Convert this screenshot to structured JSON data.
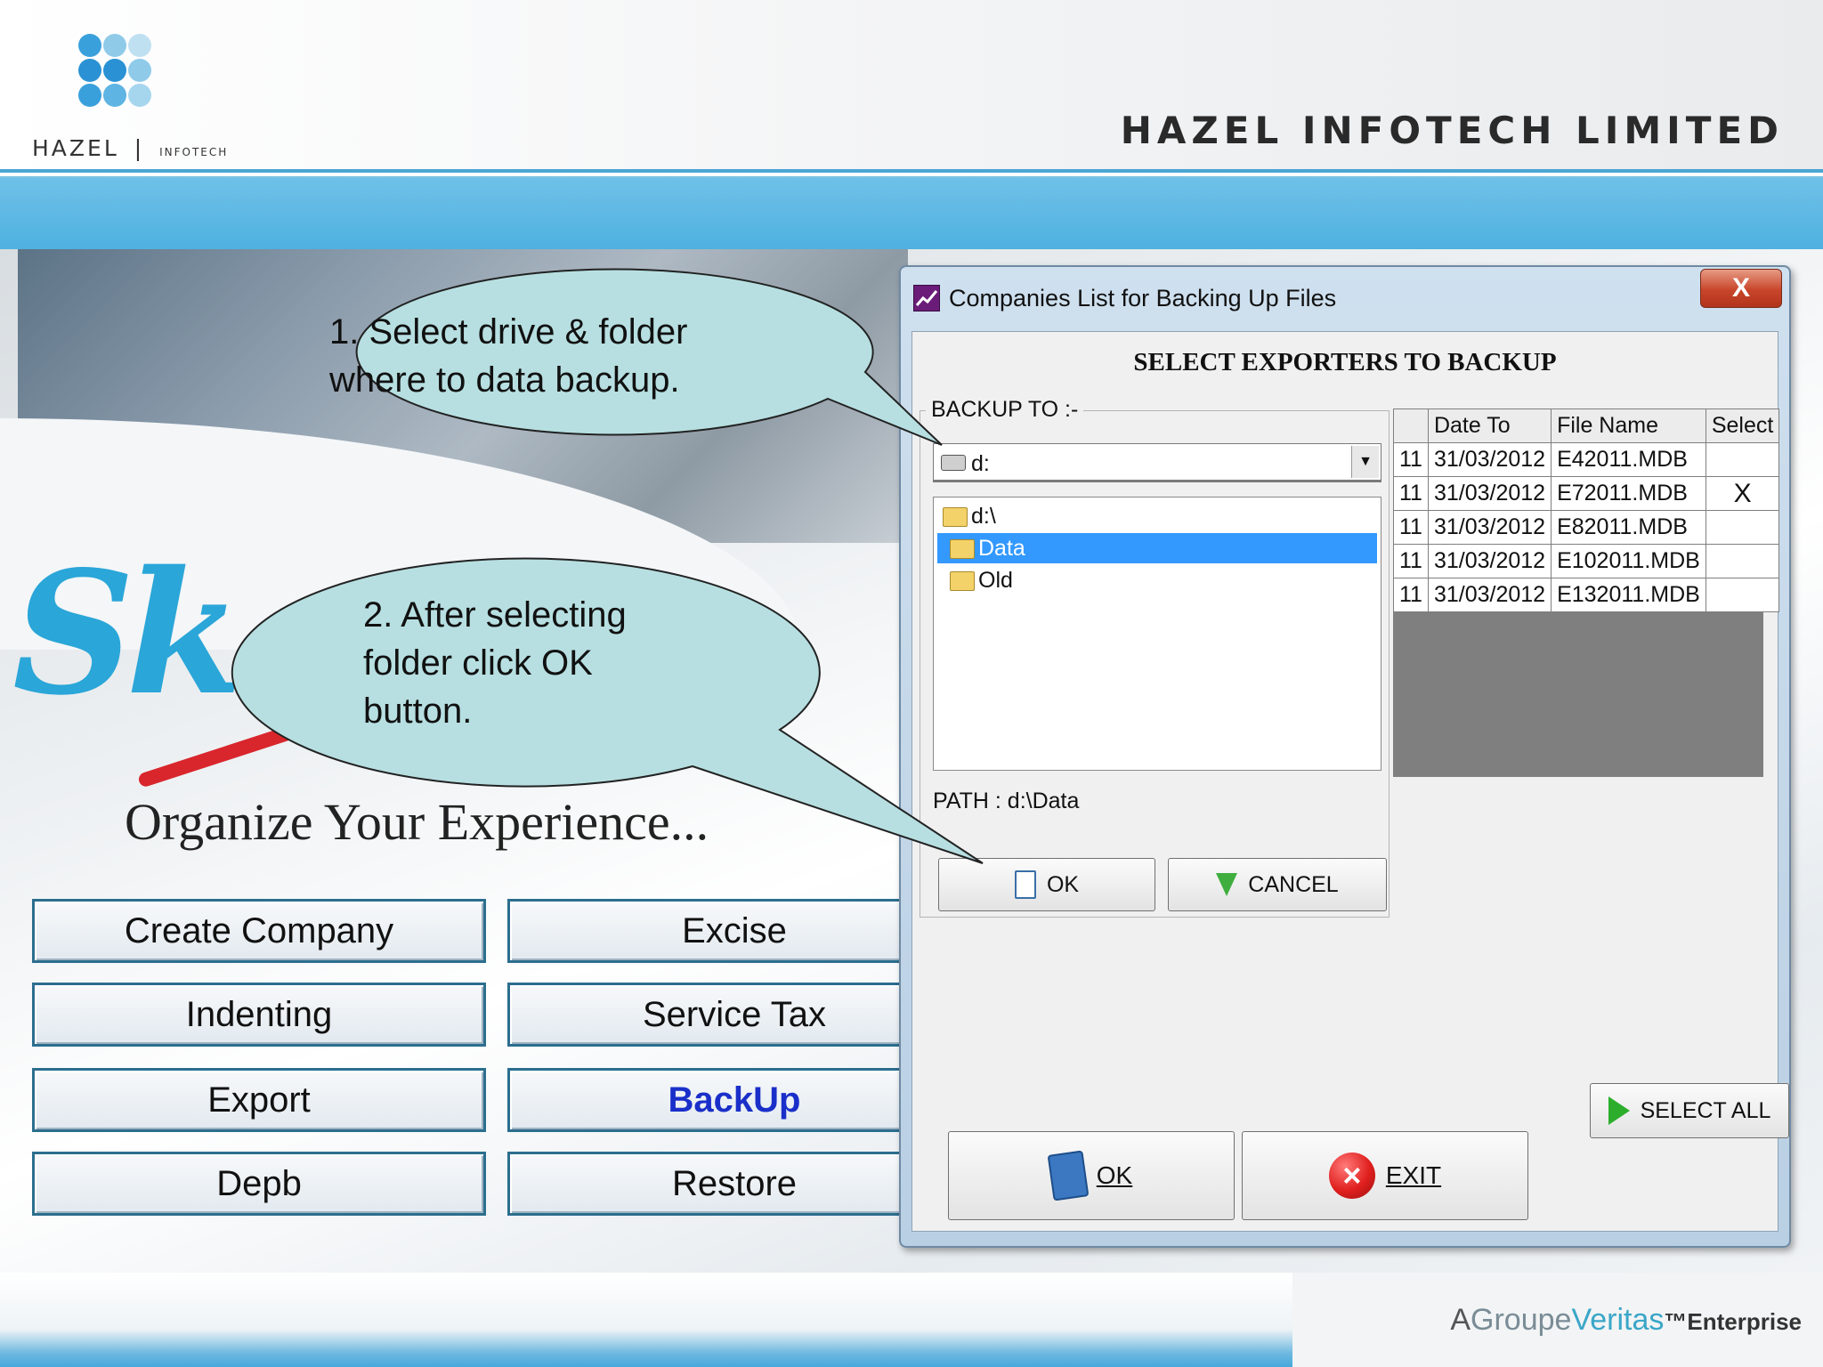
{
  "header": {
    "logo_text": "HAZEL",
    "logo_sub": "INFOTECH",
    "company_name": "HAZEL INFOTECH LIMITED"
  },
  "app": {
    "logo_text": "Sk",
    "tagline": "Organize Your Experience..."
  },
  "menu": {
    "buttons": [
      "Create Company",
      "Excise",
      "Indenting",
      "Service Tax",
      "Export",
      "BackUp",
      "Depb",
      "Restore"
    ],
    "active": "BackUp"
  },
  "dialog": {
    "title": "Companies List for Backing Up Files",
    "close_label": "X",
    "heading": "SELECT EXPORTERS TO BACKUP",
    "grid": {
      "headers": [
        "",
        "Date To",
        "File Name",
        "Select"
      ],
      "rows": [
        {
          "stub": "11",
          "date_to": "31/03/2012",
          "file_name": "E42011.MDB",
          "select": ""
        },
        {
          "stub": "11",
          "date_to": "31/03/2012",
          "file_name": "E72011.MDB",
          "select": "X"
        },
        {
          "stub": "11",
          "date_to": "31/03/2012",
          "file_name": "E82011.MDB",
          "select": ""
        },
        {
          "stub": "11",
          "date_to": "31/03/2012",
          "file_name": "E102011.MDB",
          "select": ""
        },
        {
          "stub": "11",
          "date_to": "31/03/2012",
          "file_name": "E132011.MDB",
          "select": ""
        }
      ]
    },
    "backup": {
      "group_label": "BACKUP TO :-",
      "drive_value": "d:",
      "folders": [
        {
          "label": "d:\\",
          "selected": false,
          "indent": 0
        },
        {
          "label": "Data",
          "selected": true,
          "indent": 1
        },
        {
          "label": "Old",
          "selected": false,
          "indent": 1
        }
      ],
      "path": "PATH : d:\\Data",
      "ok_label": "OK",
      "cancel_label": "CANCEL"
    },
    "select_all_label": "SELECT ALL",
    "ok_label": "OK",
    "exit_label": "EXIT"
  },
  "callouts": {
    "one": "1.  Select  drive & folder where to data backup.",
    "two": "2.  After selecting folder click OK button."
  },
  "footer": {
    "brand_prefix": "A",
    "brand_groupe": "Groupe",
    "brand_veritas": "Veritas",
    "brand_tm": "™",
    "brand_suffix": "Enterprise"
  },
  "colors": {
    "band_blue": "#4fb1e0",
    "callout_fill": "#b7dfe1",
    "selection_blue": "#3399ff",
    "active_menu_text": "#1a2fc9"
  }
}
